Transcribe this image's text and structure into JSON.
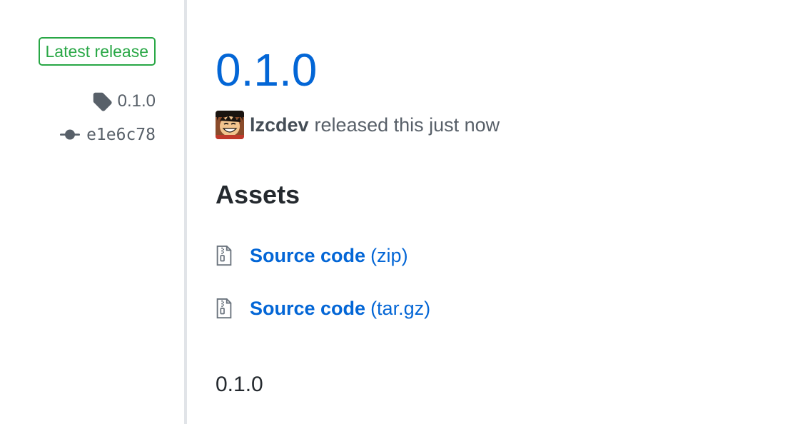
{
  "sidebar": {
    "badge_label": "Latest release",
    "tag": "0.1.0",
    "commit": "e1e6c78"
  },
  "release": {
    "title": "0.1.0",
    "author": "lzcdev",
    "byline_text": "released this just now",
    "assets_heading": "Assets",
    "assets": [
      {
        "name": "Source code",
        "ext": "(zip)",
        "icon": "file-zip-icon"
      },
      {
        "name": "Source code",
        "ext": "(tar.gz)",
        "icon": "file-zip-icon"
      }
    ],
    "body": "0.1.0"
  },
  "colors": {
    "link": "#0366d6",
    "badge_green": "#28a745",
    "muted": "#586069",
    "divider": "#e1e4e8"
  }
}
